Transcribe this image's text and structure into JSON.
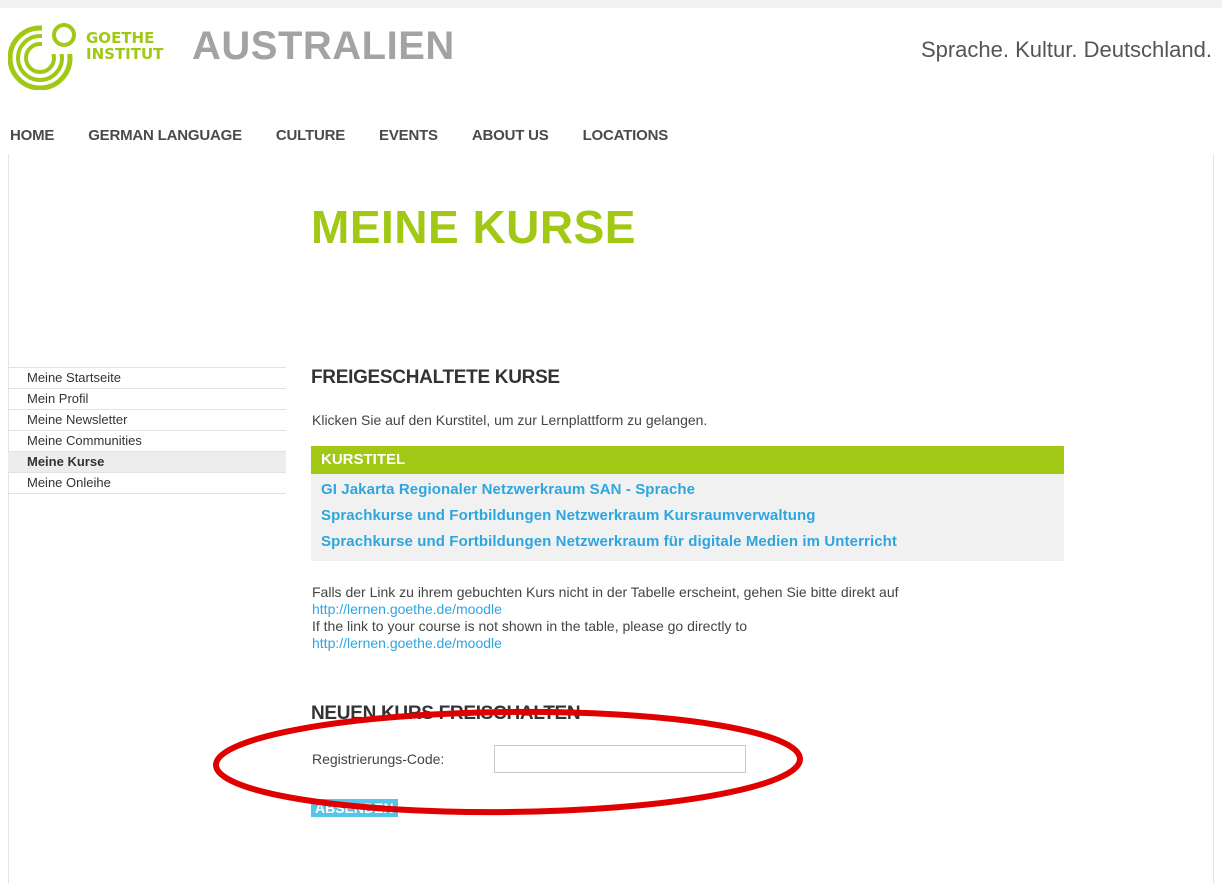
{
  "header": {
    "logo_line1": "GOETHE",
    "logo_line2": "INSTITUT",
    "site_title": "AUSTRALIEN",
    "slogan": "Sprache. Kultur. Deutschland."
  },
  "nav": {
    "items": [
      {
        "label": "HOME"
      },
      {
        "label": "GERMAN LANGUAGE"
      },
      {
        "label": "CULTURE"
      },
      {
        "label": "EVENTS"
      },
      {
        "label": "ABOUT US"
      },
      {
        "label": "LOCATIONS"
      }
    ]
  },
  "page_title": "MEINE KURSE",
  "sidebar": {
    "items": [
      {
        "label": "Meine Startseite"
      },
      {
        "label": "Mein Profil"
      },
      {
        "label": "Meine Newsletter"
      },
      {
        "label": "Meine Communities"
      },
      {
        "label": "Meine Kurse",
        "active": true
      },
      {
        "label": "Meine Onleihe"
      }
    ]
  },
  "courses": {
    "heading": "FREIGESCHALTETE KURSE",
    "intro": "Klicken Sie auf den Kurstitel, um zur Lernplattform zu gelangen.",
    "table_header": "KURSTITEL",
    "rows": [
      {
        "title": "GI Jakarta Regionaler Netzwerkraum SAN - Sprache"
      },
      {
        "title": "Sprachkurse und Fortbildungen Netzwerkraum Kursraumverwaltung"
      },
      {
        "title": "Sprachkurse und Fortbildungen Netzwerkraum für digitale Medien im Unterricht"
      }
    ]
  },
  "note": {
    "de_text": "Falls der Link zu ihrem gebuchten Kurs nicht in der Tabelle erscheint, gehen Sie bitte direkt auf",
    "de_link": "http://lernen.goethe.de/moodle",
    "en_text": "If the link to your course is not shown in the table, please go directly to",
    "en_link": "http://lernen.goethe.de/moodle"
  },
  "register": {
    "heading": "NEUEN KURS FREISCHALTEN",
    "label": "Registrierungs-Code:",
    "value": "",
    "submit_label": "ABSENDEN"
  },
  "colors": {
    "brand_green": "#a0c814",
    "link_blue": "#2da6e0",
    "button_blue": "#55c6e9",
    "annotation_red": "#e00000"
  }
}
